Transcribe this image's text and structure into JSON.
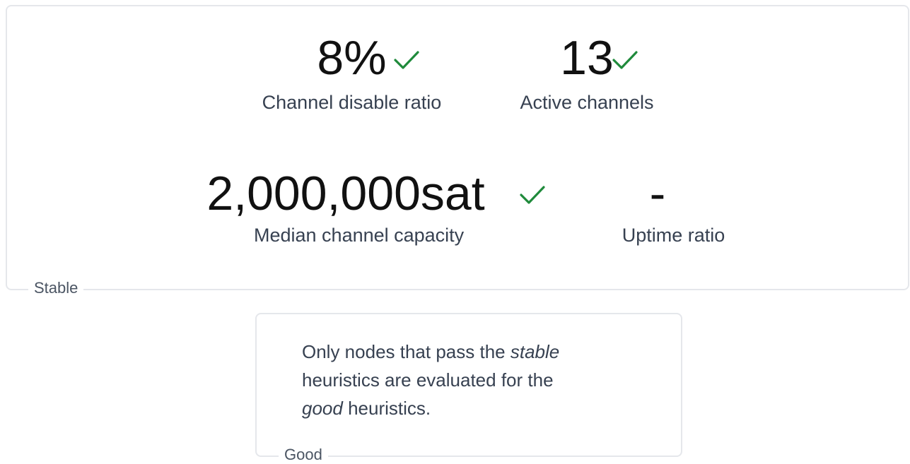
{
  "stable_section": {
    "legend": "Stable",
    "metrics": [
      {
        "value": "8%",
        "label": "Channel disable ratio",
        "status": "check-icon"
      },
      {
        "value": "13",
        "label": "Active channels",
        "status": "check-icon"
      },
      {
        "value": "2,000,000sat",
        "label": "Median channel capacity",
        "status": "check-icon"
      },
      {
        "value": "-",
        "label": "Uptime ratio",
        "status": "none"
      }
    ]
  },
  "good_section": {
    "legend": "Good",
    "note": {
      "part1": "Only nodes that pass the ",
      "em1": "stable",
      "part2": " heuristics are evaluated for the ",
      "em2": "good",
      "part3": " heuristics."
    }
  },
  "colors": {
    "check": "#1f8a3b",
    "border": "#e5e7eb",
    "text": "#374151",
    "value": "#111111"
  }
}
